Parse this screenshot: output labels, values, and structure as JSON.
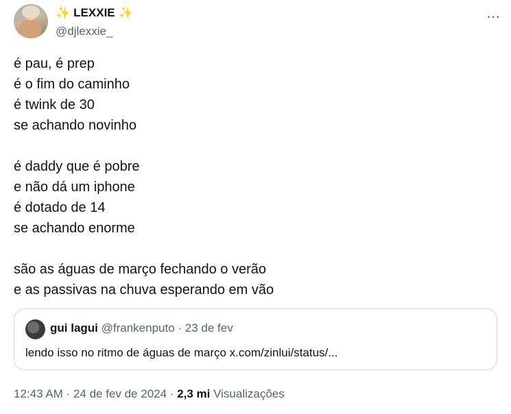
{
  "author": {
    "sparkle_left": "✨",
    "name": "LEXXIE",
    "sparkle_right": "✨",
    "handle": "@djlexxie_"
  },
  "more_icon": "⋯",
  "tweet": {
    "stanza1": [
      "é pau, é prep",
      "é o fim do caminho",
      "é twink de 30",
      "se achando novinho"
    ],
    "stanza2": [
      "é daddy que é pobre",
      "e não dá um iphone",
      "é dotado de 14",
      "se achando enorme"
    ],
    "stanza3": [
      "são as águas de março fechando o verão",
      "e as passivas na chuva esperando em vão"
    ]
  },
  "quote": {
    "name": "gui lagui",
    "handle": "@frankenputo",
    "sep": " · ",
    "date": "23 de fev",
    "text": "lendo isso no ritmo de águas de março x.com/zinlui/status/..."
  },
  "footer": {
    "time": "12:43 AM",
    "sep1": " · ",
    "date": "24 de fev de 2024",
    "sep2": " · ",
    "views_count": "2,3 mi",
    "views_label": "Visualizações"
  }
}
